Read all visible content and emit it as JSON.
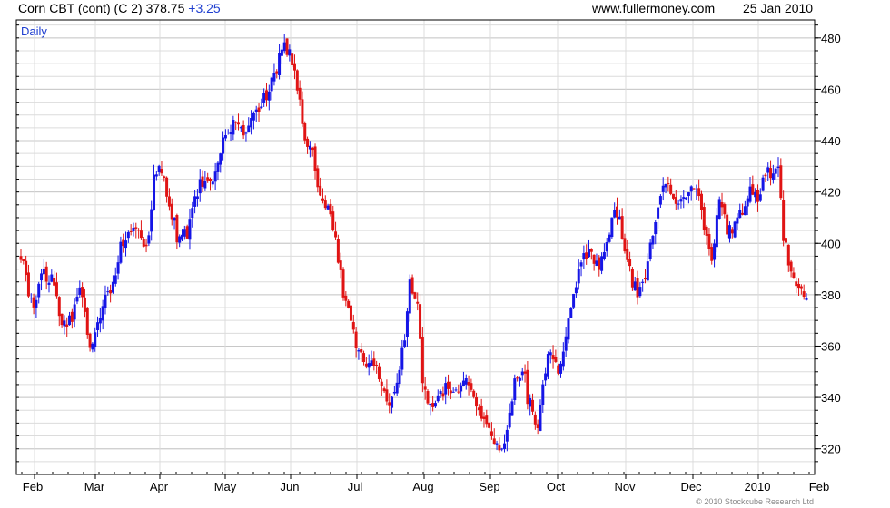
{
  "header": {
    "instrument": "Corn CBT (cont) (C 2)",
    "price": "378.75",
    "change": "+3.25",
    "website": "www.fullermoney.com",
    "date": "25 Jan 2010"
  },
  "footer": {
    "copyright": "© 2010 Stockcube Research Ltd"
  },
  "colors": {
    "up": "#1515e6",
    "down": "#e01414",
    "grid": "#dcdcdc",
    "border": "#000000",
    "label_blue": "#1f3fd0"
  },
  "chart_data": {
    "type": "ohlc",
    "period_label": "Daily",
    "ylim": [
      310,
      487
    ],
    "y_axis_side": "right",
    "y_ticks": [
      320,
      340,
      360,
      380,
      400,
      420,
      440,
      460,
      480
    ],
    "x_labels": [
      "Feb",
      "Mar",
      "Apr",
      "May",
      "Jun",
      "Jul",
      "Aug",
      "Sep",
      "Oct",
      "Nov",
      "Dec",
      "2010",
      "Feb"
    ],
    "grid": true,
    "waypoints": [
      [
        0,
        395
      ],
      [
        5,
        373
      ],
      [
        8,
        388
      ],
      [
        12,
        386
      ],
      [
        16,
        367
      ],
      [
        20,
        372
      ],
      [
        23,
        382
      ],
      [
        27,
        360
      ],
      [
        31,
        373
      ],
      [
        35,
        383
      ],
      [
        39,
        398
      ],
      [
        42,
        403
      ],
      [
        46,
        405
      ],
      [
        48,
        398
      ],
      [
        50,
        405
      ],
      [
        52,
        424
      ],
      [
        54,
        432
      ],
      [
        58,
        415
      ],
      [
        61,
        403
      ],
      [
        65,
        403
      ],
      [
        69,
        420
      ],
      [
        71,
        425
      ],
      [
        74,
        423
      ],
      [
        77,
        430
      ],
      [
        80,
        443
      ],
      [
        84,
        448
      ],
      [
        87,
        445
      ],
      [
        91,
        448
      ],
      [
        96,
        458
      ],
      [
        99,
        465
      ],
      [
        103,
        478
      ],
      [
        106,
        470
      ],
      [
        109,
        455
      ],
      [
        111,
        438
      ],
      [
        114,
        434
      ],
      [
        117,
        420
      ],
      [
        120,
        415
      ],
      [
        123,
        400
      ],
      [
        126,
        381
      ],
      [
        129,
        372
      ],
      [
        131,
        360
      ],
      [
        134,
        352
      ],
      [
        138,
        355
      ],
      [
        141,
        342
      ],
      [
        144,
        338
      ],
      [
        147,
        348
      ],
      [
        150,
        362
      ],
      [
        152,
        385
      ],
      [
        155,
        375
      ],
      [
        157,
        346
      ],
      [
        160,
        336
      ],
      [
        164,
        340
      ],
      [
        167,
        344
      ],
      [
        170,
        341
      ],
      [
        173,
        346
      ],
      [
        176,
        342
      ],
      [
        179,
        337
      ],
      [
        182,
        327
      ],
      [
        185,
        323
      ],
      [
        187,
        318
      ],
      [
        190,
        327
      ],
      [
        193,
        345
      ],
      [
        196,
        353
      ],
      [
        198,
        340
      ],
      [
        202,
        330
      ],
      [
        205,
        350
      ],
      [
        207,
        360
      ],
      [
        210,
        350
      ],
      [
        213,
        366
      ],
      [
        216,
        380
      ],
      [
        219,
        392
      ],
      [
        223,
        398
      ],
      [
        226,
        388
      ],
      [
        229,
        402
      ],
      [
        232,
        412
      ],
      [
        234,
        408
      ],
      [
        236,
        399
      ],
      [
        239,
        384
      ],
      [
        241,
        382
      ],
      [
        244,
        386
      ],
      [
        246,
        400
      ],
      [
        249,
        413
      ],
      [
        252,
        425
      ],
      [
        255,
        420
      ],
      [
        258,
        415
      ],
      [
        261,
        422
      ],
      [
        264,
        420
      ],
      [
        267,
        408
      ],
      [
        270,
        395
      ],
      [
        273,
        416
      ],
      [
        276,
        405
      ],
      [
        279,
        407
      ],
      [
        282,
        413
      ],
      [
        285,
        420
      ],
      [
        288,
        416
      ],
      [
        291,
        428
      ],
      [
        294,
        428
      ],
      [
        296,
        429
      ],
      [
        298,
        403
      ],
      [
        300,
        393
      ],
      [
        302,
        386
      ],
      [
        305,
        380
      ],
      [
        307,
        378
      ]
    ],
    "bars_total": 308
  }
}
